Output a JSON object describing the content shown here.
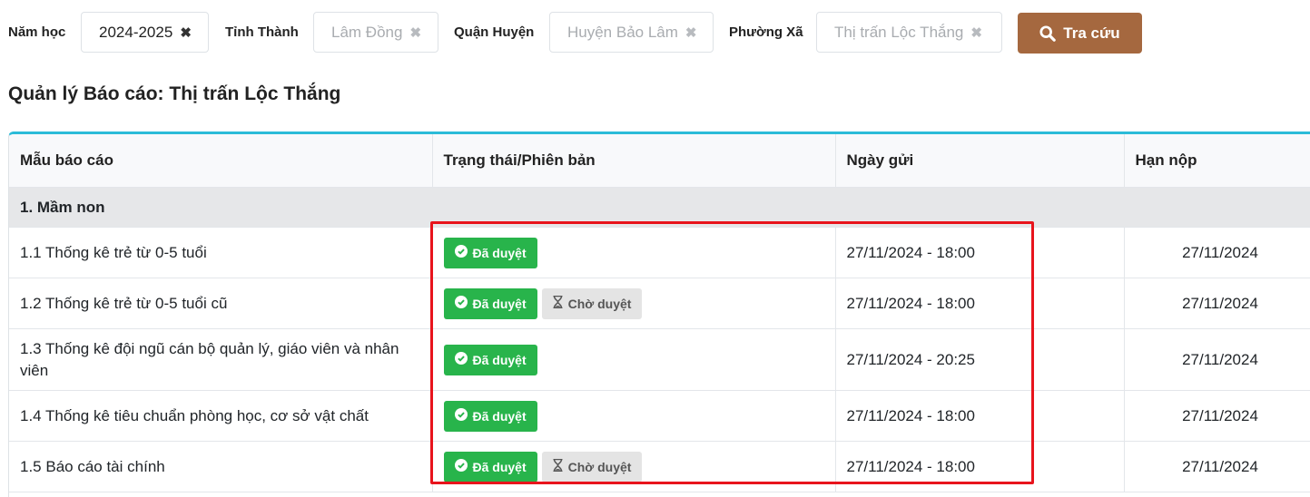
{
  "filters": {
    "year_label": "Năm học",
    "year_value": "2024-2025",
    "province_label": "Tỉnh Thành",
    "province_value": "Lâm Đồng",
    "district_label": "Quận Huyện",
    "district_value": "Huyện Bảo Lâm",
    "ward_label": "Phường Xã",
    "ward_value": "Thị trấn Lộc Thắng",
    "clear_icon": "times-icon",
    "search_label": "Tra cứu",
    "search_icon": "search-icon"
  },
  "page_title": "Quản lý Báo cáo: Thị trấn Lộc Thắng",
  "table": {
    "headers": [
      "Mẫu báo cáo",
      "Trạng thái/Phiên bản",
      "Ngày gửi",
      "Hạn nộp"
    ],
    "group": "1. Mầm non",
    "badge_labels": {
      "approved": "Đã duyệt",
      "pending": "Chờ duyệt"
    },
    "rows": [
      {
        "name": "1.1 Thống kê trẻ từ 0-5 tuổi",
        "sent": "27/11/2024 - 18:00",
        "due": "27/11/2024"
      },
      {
        "name": "1.2 Thống kê trẻ từ 0-5 tuổi cũ",
        "sent": "27/11/2024 - 18:00",
        "due": "27/11/2024"
      },
      {
        "name": "1.3 Thống kê đội ngũ cán bộ quản lý, giáo viên và nhân viên",
        "sent": "27/11/2024 - 20:25",
        "due": "27/11/2024"
      },
      {
        "name": "1.4 Thống kê tiêu chuẩn phòng học, cơ sở vật chất",
        "sent": "27/11/2024 - 18:00",
        "due": "27/11/2024"
      },
      {
        "name": "1.5 Báo cáo tài chính",
        "sent": "27/11/2024 - 18:00",
        "due": "27/11/2024"
      }
    ]
  },
  "colors": {
    "search_button": "#a5683f",
    "table_accent": "#2bbbd8",
    "approved_badge": "#28b44b",
    "pending_badge": "#e4e4e4",
    "highlight_box": "#e8141c"
  }
}
